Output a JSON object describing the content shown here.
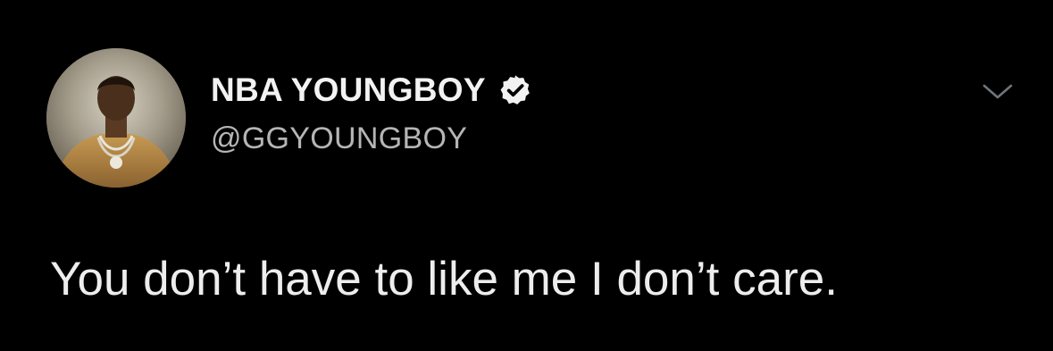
{
  "tweet": {
    "display_name": "NBA YOUNGBOY",
    "handle": "@GGYOUNGBOY",
    "text": "You don’t have to like me I don’t care.",
    "verified": true
  },
  "icons": {
    "verified": "verified-badge-icon",
    "menu": "chevron-down-icon"
  },
  "colors": {
    "background": "#000000",
    "name": "#f2f2f2",
    "handle": "#b5b5b5",
    "text": "#ededed",
    "caret": "#6e767d"
  }
}
